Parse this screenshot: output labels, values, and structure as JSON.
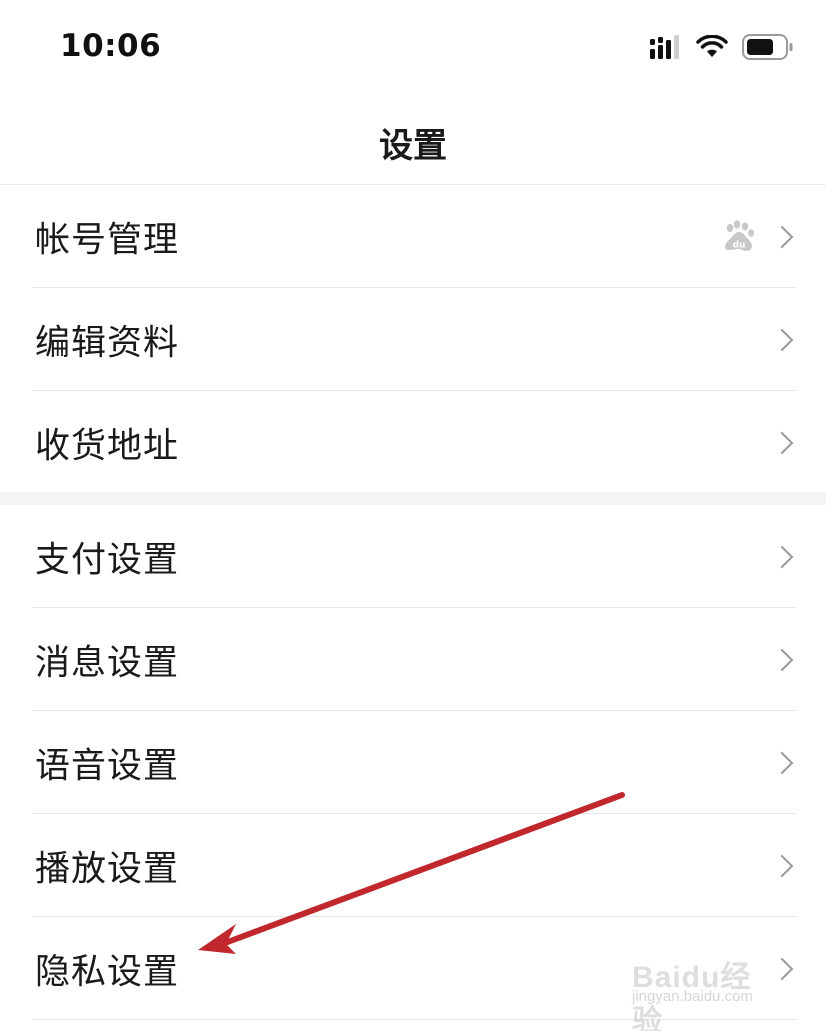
{
  "status_bar": {
    "time": "10:06",
    "signal_icon": "cellular-signal-icon",
    "wifi_icon": "wifi-icon",
    "battery_icon": "battery-icon"
  },
  "nav": {
    "title": "设置"
  },
  "groups": [
    {
      "items": [
        {
          "label": "帐号管理",
          "badge_icon": "baidu-paw-icon"
        },
        {
          "label": "编辑资料"
        },
        {
          "label": "收货地址"
        }
      ]
    },
    {
      "items": [
        {
          "label": "支付设置"
        },
        {
          "label": "消息设置"
        },
        {
          "label": "语音设置"
        },
        {
          "label": "播放设置"
        },
        {
          "label": "隐私设置"
        }
      ]
    }
  ],
  "annotation": {
    "arrow_color": "#c0282d",
    "arrow_icon": "red-arrow-annotation"
  },
  "watermark": {
    "text": "Baidu经验",
    "subtext": "jingyan.baidu.com"
  },
  "colors": {
    "chevron": "#9a9a9a",
    "divider": "#e8e8e8",
    "section_gap": "#f4f4f4"
  }
}
